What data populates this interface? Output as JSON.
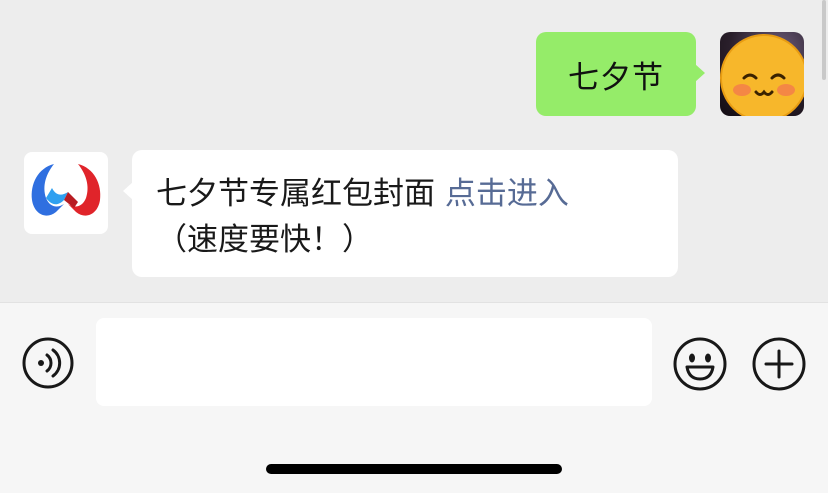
{
  "messages": {
    "sent": {
      "text": "七夕节",
      "avatar_icon": "emoji-face-avatar"
    },
    "received": {
      "text_main": "七夕节专属红包封面",
      "link": "点击进入",
      "text_sub": "（速度要快！）",
      "avatar_icon": "red-blue-w-logo"
    }
  },
  "input_bar": {
    "voice_icon": "voice-icon",
    "placeholder": "",
    "emoji_icon": "smiley-icon",
    "more_icon": "plus-circle-icon"
  },
  "colors": {
    "sent_bubble": "#95ec69",
    "link": "#576b95",
    "background": "#ededed"
  }
}
